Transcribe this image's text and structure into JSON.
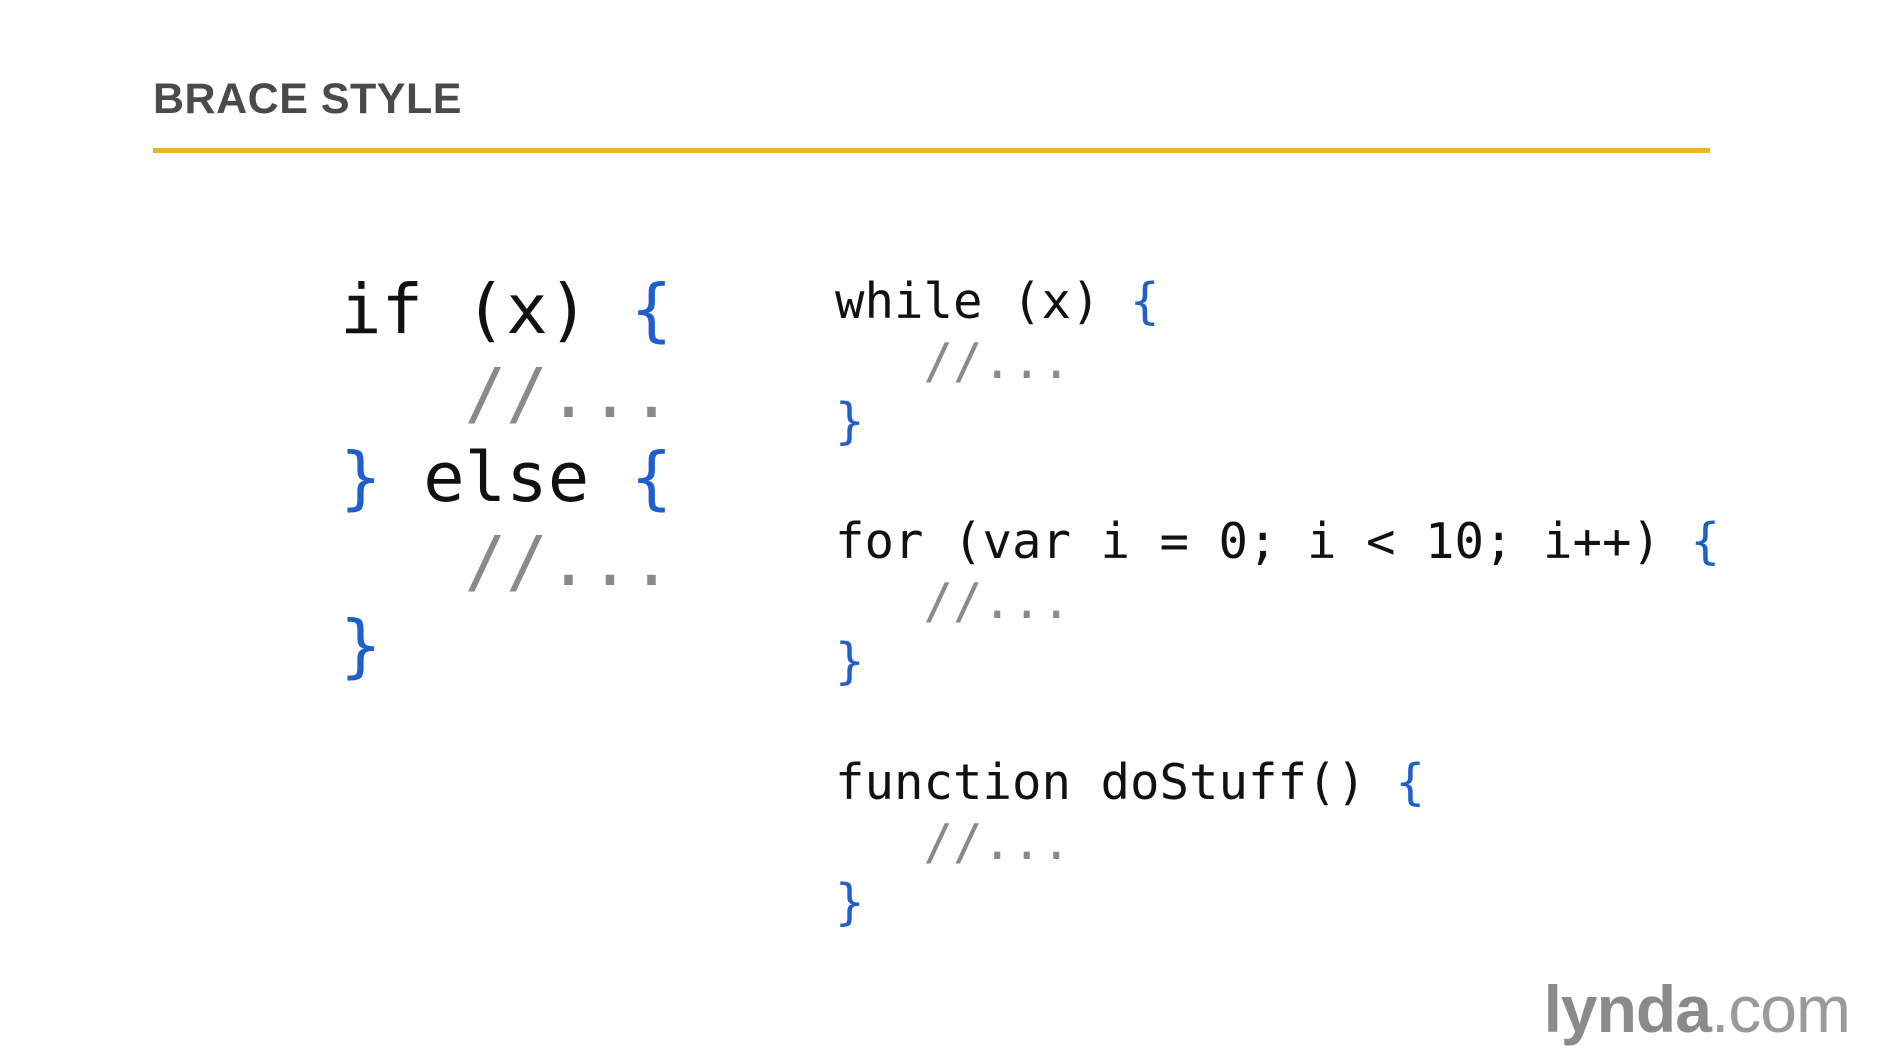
{
  "slide": {
    "title": "BRACE STYLE",
    "accent_color": "#f0b429",
    "brace_color": "#1f5fcc",
    "comment_color": "#8a8a8a"
  },
  "code": {
    "if_else": {
      "line1_code": "if (x) ",
      "line1_brace": "{",
      "line2_comment": "   //...",
      "line3_brace_close": "}",
      "line3_code": " else ",
      "line3_brace_open": "{",
      "line4_comment": "   //...",
      "line5_brace": "}"
    },
    "while_loop": {
      "line1_code": "while (x) ",
      "line1_brace": "{",
      "line2_comment": "   //...",
      "line3_brace": "}"
    },
    "for_loop": {
      "line1_code": "for (var i = 0; i < 10; i++) ",
      "line1_brace": "{",
      "line2_comment": "   //...",
      "line3_brace": "}"
    },
    "function_decl": {
      "line1_code": "function doStuff() ",
      "line1_brace": "{",
      "line2_comment": "   //...",
      "line3_brace": "}"
    }
  },
  "logo": {
    "brand": "lynda",
    "tld": ".com"
  }
}
